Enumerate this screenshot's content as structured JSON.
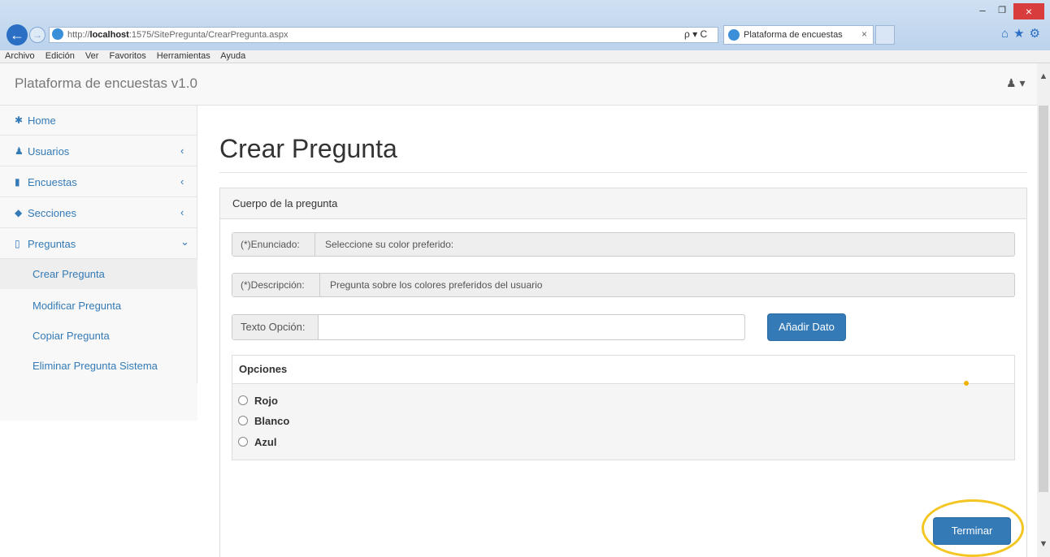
{
  "browser": {
    "url_prefix": "http://",
    "url_host": "localhost",
    "url_path": ":1575/SitePregunta/CrearPregunta.aspx",
    "search_controls": "ρ ▾ C",
    "tab_title": "Plataforma de encuestas",
    "tab_close": "×",
    "back_glyph": "←",
    "forward_glyph": "→",
    "window_min": "–",
    "window_max": "❐",
    "window_close": "×",
    "toolbar_glyphs": "⌂★⚙",
    "menu": [
      "Archivo",
      "Edición",
      "Ver",
      "Favoritos",
      "Herramientas",
      "Ayuda"
    ]
  },
  "app": {
    "title": "Plataforma de encuestas v1.0",
    "user_menu": "♟ ▾"
  },
  "sidebar": {
    "items": [
      {
        "label": "Home",
        "icon": "home-icon",
        "glyph": "✱",
        "chevron": ""
      },
      {
        "label": "Usuarios",
        "icon": "users-icon",
        "glyph": "♟",
        "chevron": "‹"
      },
      {
        "label": "Encuestas",
        "icon": "bookmark-icon",
        "glyph": "▮",
        "chevron": "‹"
      },
      {
        "label": "Secciones",
        "icon": "tags-icon",
        "glyph": "◆",
        "chevron": "‹"
      },
      {
        "label": "Preguntas",
        "icon": "bookmark-outline-icon",
        "glyph": "▯",
        "chevron": "⌄"
      }
    ],
    "subitems": [
      "Crear Pregunta",
      "Modificar Pregunta",
      "Copiar Pregunta",
      "Eliminar Pregunta Sistema"
    ]
  },
  "main": {
    "page_title": "Crear Pregunta",
    "panel_heading": "Cuerpo de la pregunta",
    "enunciado_label": "(*)Enunciado:",
    "enunciado_value": "Seleccione su color preferido:",
    "descripcion_label": "(*)Descripción:",
    "descripcion_value": "Pregunta sobre los colores preferidos del usuario",
    "texto_opcion_label": "Texto Opción:",
    "texto_opcion_value": "",
    "add_button": "Añadir Dato",
    "options_heading": "Opciones",
    "options": [
      "Rojo",
      "Blanco",
      "Azul"
    ],
    "finish_button": "Terminar"
  },
  "colors": {
    "primary": "#337ab7",
    "highlight": "#f3c623",
    "close": "#d93c3c"
  }
}
